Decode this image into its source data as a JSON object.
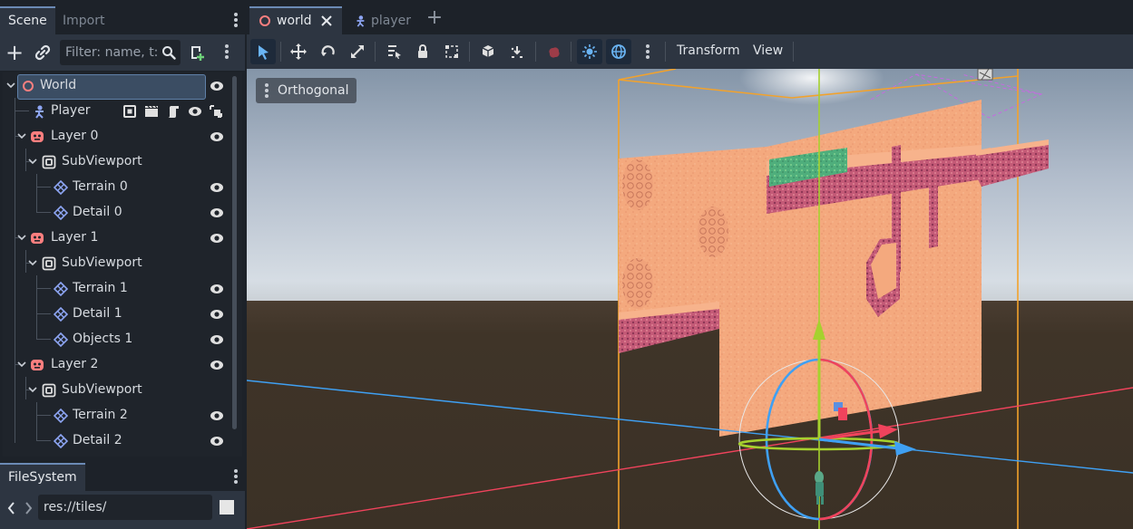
{
  "scene_dock": {
    "tabs": [
      {
        "label": "Scene"
      },
      {
        "label": "Import"
      }
    ],
    "filter_placeholder": "Filter: name, t:t",
    "tree": [
      {
        "label": "World",
        "icon": "node3d-icon"
      },
      {
        "label": "Player",
        "icon": "character-icon"
      },
      {
        "label": "Layer 0",
        "icon": "layer-icon"
      },
      {
        "label": "SubViewport",
        "icon": "subviewport-icon"
      },
      {
        "label": "Terrain 0",
        "icon": "tilemap-icon"
      },
      {
        "label": "Detail 0",
        "icon": "tilemap-icon"
      },
      {
        "label": "Layer 1",
        "icon": "layer-icon"
      },
      {
        "label": "SubViewport",
        "icon": "subviewport-icon"
      },
      {
        "label": "Terrain 1",
        "icon": "tilemap-icon"
      },
      {
        "label": "Detail 1",
        "icon": "tilemap-icon"
      },
      {
        "label": "Objects 1",
        "icon": "tilemap-icon"
      },
      {
        "label": "Layer 2",
        "icon": "layer-icon"
      },
      {
        "label": "SubViewport",
        "icon": "subviewport-icon"
      },
      {
        "label": "Terrain 2",
        "icon": "tilemap-icon"
      },
      {
        "label": "Detail 2",
        "icon": "tilemap-icon"
      }
    ]
  },
  "filesystem_dock": {
    "tab_label": "FileSystem",
    "path": "res://tiles/"
  },
  "editor": {
    "scene_tabs": [
      {
        "label": "world"
      },
      {
        "label": "player"
      }
    ],
    "toolbar": {
      "transform_menu": "Transform",
      "view_menu": "View"
    },
    "viewport": {
      "projection_label": "Orthogonal"
    }
  },
  "colors": {
    "accent": "#6b8ab5",
    "terrain": "#f4a97e",
    "terrain_edge": "#b04b6c",
    "grass": "#4fae7c",
    "axis_x": "#f0435c",
    "axis_y": "#a6d12e",
    "axis_z": "#3fa0f3",
    "bounds": "#f2a22c"
  }
}
